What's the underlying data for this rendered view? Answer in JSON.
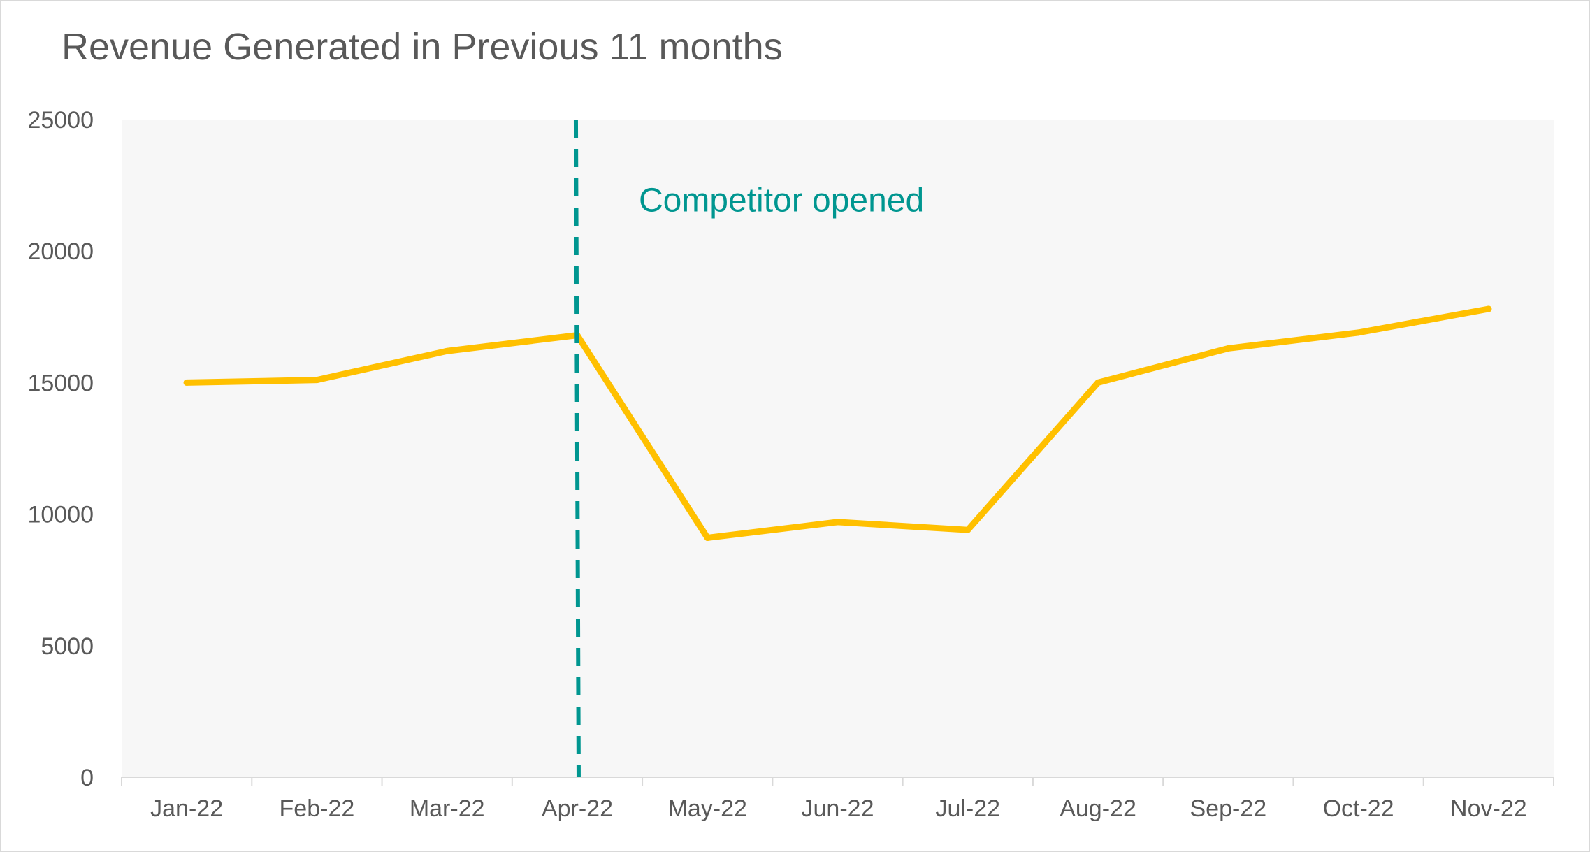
{
  "chart_data": {
    "type": "line",
    "title": "Revenue Generated in Previous 11 months",
    "xlabel": "",
    "ylabel": "",
    "categories": [
      "Jan-22",
      "Feb-22",
      "Mar-22",
      "Apr-22",
      "May-22",
      "Jun-22",
      "Jul-22",
      "Aug-22",
      "Sep-22",
      "Oct-22",
      "Nov-22"
    ],
    "series": [
      {
        "values": [
          15000,
          15100,
          16200,
          16800,
          9100,
          9700,
          9400,
          15000,
          16300,
          16900,
          17800
        ],
        "color": "#FFC000"
      }
    ],
    "ylim": [
      0,
      25000
    ],
    "yticks": [
      0,
      5000,
      10000,
      15000,
      20000,
      25000
    ],
    "grid": false,
    "legend": "none",
    "plot_background": "#F7F7F7",
    "annotations": [
      {
        "type": "vline",
        "x_category": "Apr-22",
        "style": "dashed",
        "color": "#009690",
        "label": "Competitor opened",
        "label_y": 21500
      }
    ]
  }
}
